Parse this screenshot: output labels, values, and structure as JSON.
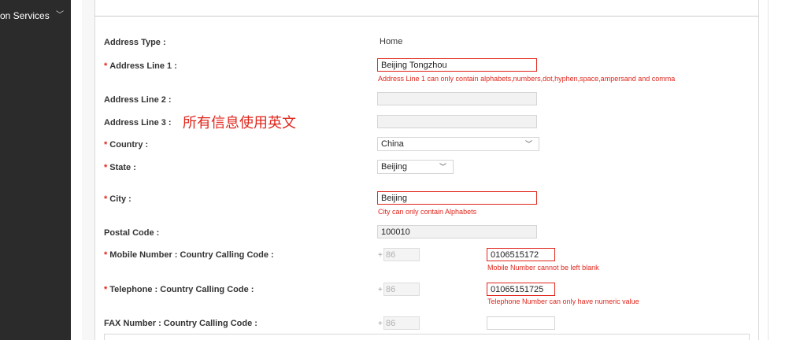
{
  "sidebar": {
    "item_label": "on Services"
  },
  "form": {
    "address_type": {
      "label": "Address Type :",
      "value": "Home"
    },
    "address_line1": {
      "label": "Address Line 1 :",
      "value": "Beijing Tongzhou",
      "error": "Address Line 1 can only contain alphabets,numbers,dot,hyphen,space,ampersand and comma"
    },
    "address_line2": {
      "label": "Address Line 2 :",
      "value": ""
    },
    "address_line3": {
      "label": "Address Line 3 :",
      "value": "",
      "note": "所有信息使用英文"
    },
    "country": {
      "label": "Country :",
      "value": "China"
    },
    "state": {
      "label": "State :",
      "value": "Beijing"
    },
    "city": {
      "label": "City :",
      "value": "Beijing",
      "error": "City can only contain Alphabets"
    },
    "postal_code": {
      "label": "Postal Code :",
      "value": "100010"
    },
    "mobile": {
      "label": "Mobile Number : Country Calling Code :",
      "plus": "+",
      "code": "86",
      "value": "0106515172",
      "error": "Mobile Number cannot be left blank"
    },
    "telephone": {
      "label": "Telephone : Country Calling Code :",
      "plus": "+",
      "code": "86",
      "value": "01065151725",
      "error": "Telephone Number can only have numeric value"
    },
    "fax": {
      "label": "FAX Number : Country Calling Code :",
      "plus": "+",
      "code": "86",
      "value": ""
    },
    "required_marker": "*"
  },
  "colors": {
    "error": "#e0261c",
    "sidebar_bg": "#2b2b2b"
  }
}
